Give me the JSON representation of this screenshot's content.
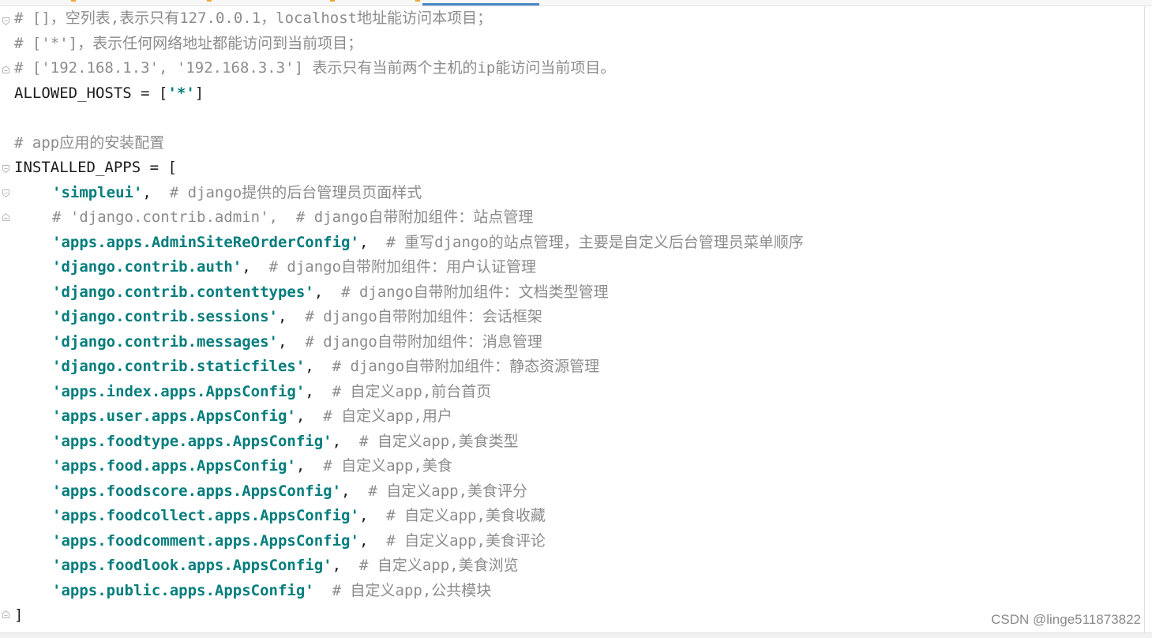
{
  "editor": {
    "lines": [
      {
        "comment": "# []，空列表,表示只有127.0.0.1，localhost地址能访问本项目；"
      },
      {
        "comment": "# ['*']，表示任何网络地址都能访问到当前项目；"
      },
      {
        "comment": "# ['192.168.1.3', '192.168.3.3'] 表示只有当前两个主机的ip能访问当前项目。"
      },
      {
        "code": "ALLOWED_HOSTS = [",
        "string": "'*'",
        "close": "]"
      },
      {},
      {
        "comment": "# app应用的安装配置"
      },
      {
        "code": "INSTALLED_APPS = ["
      },
      {
        "indent": true,
        "string": "'simpleui'",
        "code": ",  ",
        "comment": "# django提供的后台管理员页面样式"
      },
      {
        "indent": true,
        "comment": "# 'django.contrib.admin',  # django自带附加组件：站点管理"
      },
      {
        "indent": true,
        "string": "'apps.apps.AdminSiteReOrderConfig'",
        "code": ",  ",
        "comment": "# 重写django的站点管理，主要是自定义后台管理员菜单顺序"
      },
      {
        "indent": true,
        "string": "'django.contrib.auth'",
        "code": ",  ",
        "comment": "# django自带附加组件：用户认证管理"
      },
      {
        "indent": true,
        "string": "'django.contrib.contenttypes'",
        "code": ",  ",
        "comment": "# django自带附加组件：文档类型管理"
      },
      {
        "indent": true,
        "string": "'django.contrib.sessions'",
        "code": ",  ",
        "comment": "# django自带附加组件：会话框架"
      },
      {
        "indent": true,
        "string": "'django.contrib.messages'",
        "code": ",  ",
        "comment": "# django自带附加组件：消息管理"
      },
      {
        "indent": true,
        "string": "'django.contrib.staticfiles'",
        "code": ",  ",
        "comment": "# django自带附加组件：静态资源管理"
      },
      {
        "indent": true,
        "string": "'apps.index.apps.AppsConfig'",
        "code": ",  ",
        "comment": "# 自定义app,前台首页"
      },
      {
        "indent": true,
        "string": "'apps.user.apps.AppsConfig'",
        "code": ",  ",
        "comment": "# 自定义app,用户"
      },
      {
        "indent": true,
        "string": "'apps.foodtype.apps.AppsConfig'",
        "code": ",  ",
        "comment": "# 自定义app,美食类型"
      },
      {
        "indent": true,
        "string": "'apps.food.apps.AppsConfig'",
        "code": ",  ",
        "comment": "# 自定义app,美食"
      },
      {
        "indent": true,
        "string": "'apps.foodscore.apps.AppsConfig'",
        "code": ",  ",
        "comment": "# 自定义app,美食评分"
      },
      {
        "indent": true,
        "string": "'apps.foodcollect.apps.AppsConfig'",
        "code": ",  ",
        "comment": "# 自定义app,美食收藏"
      },
      {
        "indent": true,
        "string": "'apps.foodcomment.apps.AppsConfig'",
        "code": ",  ",
        "comment": "# 自定义app,美食评论"
      },
      {
        "indent": true,
        "string": "'apps.foodlook.apps.AppsConfig'",
        "code": ",  ",
        "comment": "# 自定义app,美食浏览"
      },
      {
        "indent": true,
        "string": "'apps.public.apps.AppsConfig'",
        "code": "  ",
        "comment": "# 自定义app,公共模块"
      },
      {
        "code": "]"
      }
    ]
  },
  "watermark": "CSDN @linge511873822",
  "colors": {
    "comment": "#8c8c8c",
    "string": "#067d7d",
    "code": "#1c1c1c",
    "active_tab_underline": "#4a88c7"
  },
  "icons": {
    "fold_open": "fold-open-icon",
    "fold_close": "fold-close-icon"
  }
}
